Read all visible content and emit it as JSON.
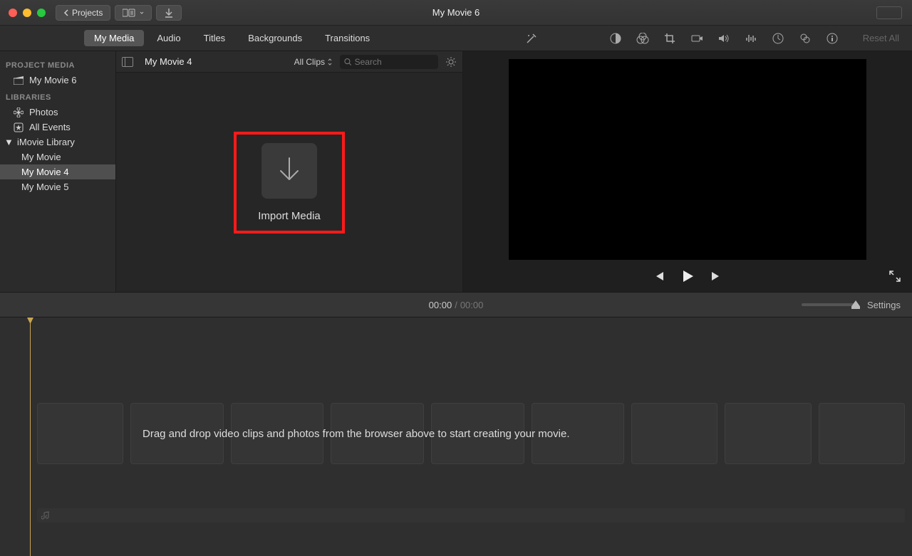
{
  "window": {
    "title": "My Movie 6",
    "back_label": "Projects"
  },
  "tabs": {
    "my_media": "My Media",
    "audio": "Audio",
    "titles": "Titles",
    "backgrounds": "Backgrounds",
    "transitions": "Transitions"
  },
  "toolbar_right": {
    "reset": "Reset All"
  },
  "sidebar": {
    "project_head": "PROJECT MEDIA",
    "project_item": "My Movie 6",
    "libraries_head": "LIBRARIES",
    "photos": "Photos",
    "all_events": "All Events",
    "imovie_library": "iMovie Library",
    "events": [
      {
        "label": "My Movie"
      },
      {
        "label": "My Movie 4"
      },
      {
        "label": "My Movie 5"
      }
    ]
  },
  "browser": {
    "title": "My Movie 4",
    "filter": "All Clips",
    "search_placeholder": "Search",
    "import_label": "Import Media"
  },
  "timecode": {
    "current": "00:00",
    "total": "00:00",
    "settings": "Settings"
  },
  "timeline": {
    "hint": "Drag and drop video clips and photos from the browser above to start creating your movie."
  }
}
